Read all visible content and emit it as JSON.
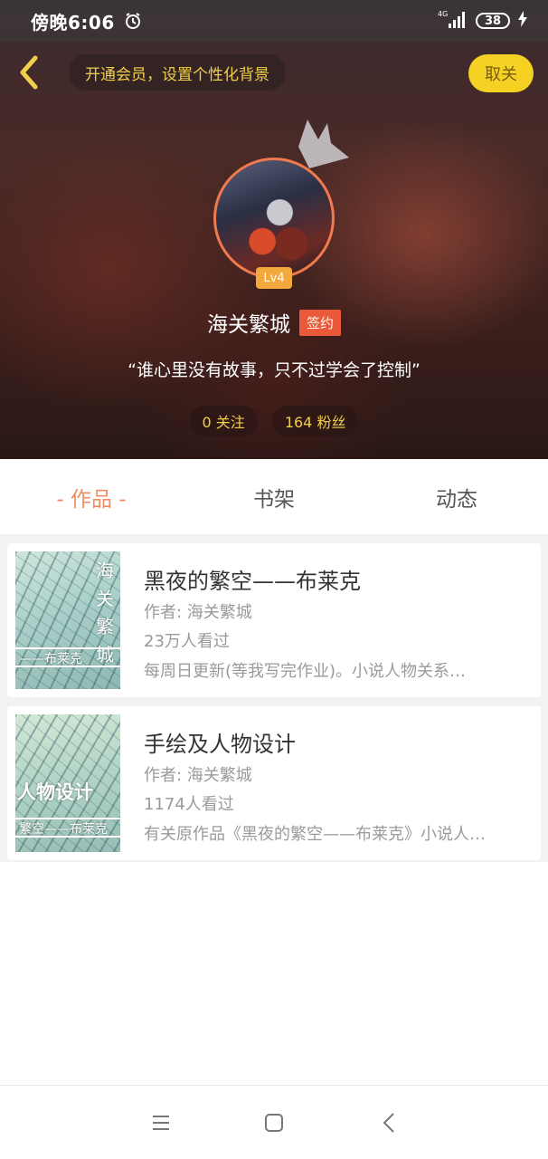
{
  "status_bar": {
    "time": "傍晚6:06",
    "network": "4G",
    "battery": "38"
  },
  "header": {
    "vip_prompt": "开通会员，设置个性化背景",
    "unfollow_label": "取关"
  },
  "profile": {
    "level": "Lv4",
    "name": "海关繁城",
    "signed_badge": "签约",
    "motto": "“谁心里没有故事，只不过学会了控制”",
    "following": "0 关注",
    "followers": "164 粉丝"
  },
  "tabs": [
    {
      "label": "- 作品 -",
      "active": true
    },
    {
      "label": "书架",
      "active": false
    },
    {
      "label": "动态",
      "active": false
    }
  ],
  "books": [
    {
      "title": "黑夜的繁空——布莱克",
      "author": "作者: 海关繁城",
      "views": "23万人看过",
      "summary": "每周日更新(等我写完作业)。小说人物关系…",
      "cover_vertical": "海关繁城",
      "cover_strip": "——布莱克"
    },
    {
      "title": "手绘及人物设计",
      "author": "作者: 海关繁城",
      "views": "1174人看过",
      "summary": "有关原作品《黑夜的繁空——布莱克》小说人…",
      "cover_big": "人物设计",
      "cover_strip": "繁空——布莱克"
    }
  ],
  "colors": {
    "accent_orange": "#ef8d62",
    "vip_yellow": "#f2cf4a",
    "unfollow_bg": "#f5d123",
    "signed_red": "#ea5a3a",
    "level_orange": "#f2a83a"
  },
  "icons": [
    "back-icon",
    "alarm-icon",
    "signal-icon",
    "battery-icon",
    "charging-icon",
    "crown-icon",
    "menu-icon",
    "home-icon",
    "nav-back-icon"
  ]
}
